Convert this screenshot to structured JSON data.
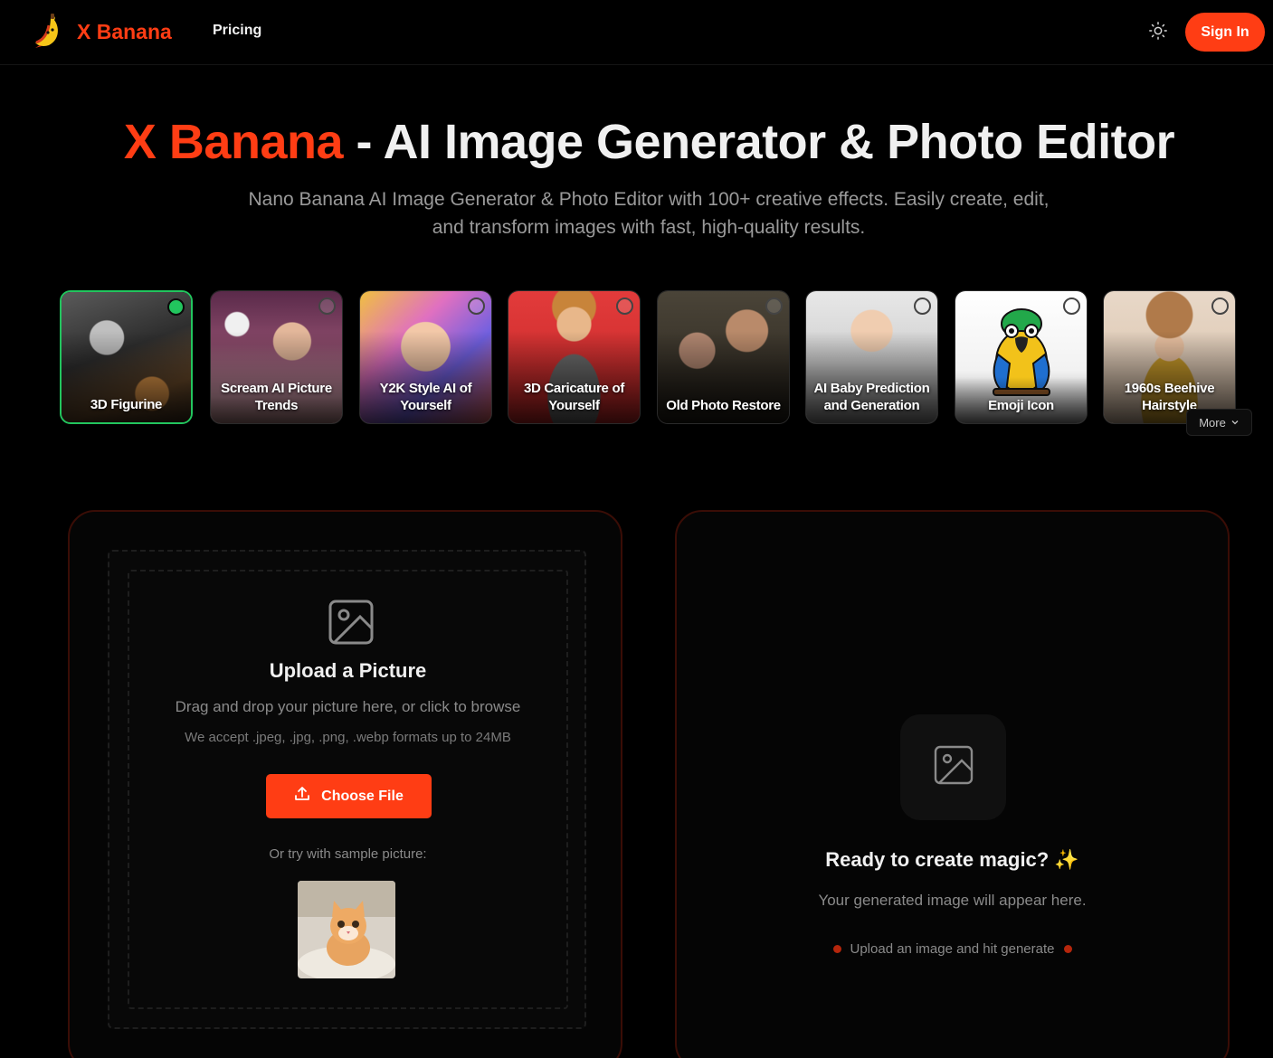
{
  "header": {
    "brand": "X Banana",
    "nav": {
      "pricing": "Pricing"
    },
    "theme_toggle_icon": "sun-icon",
    "sign_in": "Sign In"
  },
  "hero": {
    "title_accent": "X Banana",
    "title_rest": " - AI Image Generator & Photo Editor",
    "subtitle": "Nano Banana AI Image Generator & Photo Editor with 100+ creative effects. Easily create, edit, and transform images with fast, high-quality results."
  },
  "effects": {
    "items": [
      {
        "label": "3D Figurine",
        "selected": true
      },
      {
        "label": "Scream AI Picture Trends",
        "selected": false
      },
      {
        "label": "Y2K Style AI of Yourself",
        "selected": false
      },
      {
        "label": "3D Caricature of Yourself",
        "selected": false
      },
      {
        "label": "Old Photo Restore",
        "selected": false
      },
      {
        "label": "AI Baby Prediction and Generation",
        "selected": false
      },
      {
        "label": "Emoji Icon",
        "selected": false
      },
      {
        "label": "1960s Beehive Hairstyle",
        "selected": false
      }
    ],
    "more": "More"
  },
  "upload": {
    "icon": "image-icon",
    "title": "Upload a Picture",
    "description": "Drag and drop your picture here, or click to browse",
    "formats": "We accept .jpeg, .jpg, .png, .webp formats up to 24MB",
    "choose_file": "Choose File",
    "sample_label": "Or try with sample picture:"
  },
  "result": {
    "icon": "image-icon",
    "title": "Ready to create magic? ✨",
    "subtitle": "Your generated image will appear here.",
    "hint": "Upload an image and hit generate"
  },
  "colors": {
    "accent": "#ff3d14",
    "selected": "#22c55e",
    "background": "#000000"
  }
}
